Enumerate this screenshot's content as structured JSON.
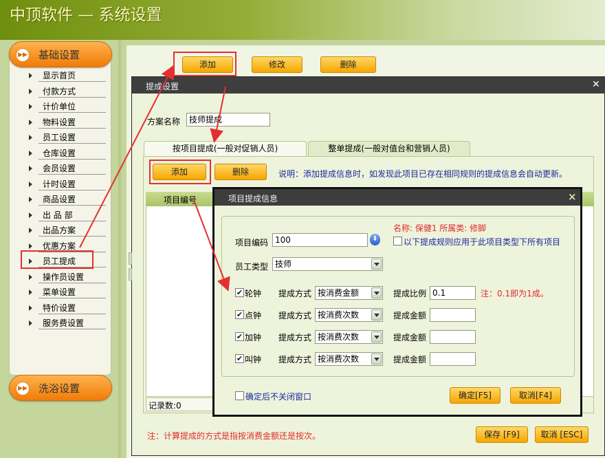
{
  "app": {
    "title": "中顶软件 — 系统设置"
  },
  "sidebar": {
    "section1": "基础设置",
    "section2": "洗浴设置",
    "items": [
      "显示首页",
      "付款方式",
      "计价单位",
      "物料设置",
      "员工设置",
      "仓库设置",
      "会员设置",
      "计时设置",
      "商品设置",
      "出 品 部",
      "出品方案",
      "优惠方案",
      "员工提成",
      "操作员设置",
      "菜单设置",
      "特价设置",
      "服务费设置"
    ],
    "active": "员工提成"
  },
  "toolbar": {
    "add": "添加",
    "edit": "修改",
    "delete": "删除"
  },
  "commission_dialog": {
    "title": "提成设置",
    "plan_name_label": "方案名称",
    "plan_name_value": "技师提成",
    "tabs": [
      "按项目提成(一般对促销人员)",
      "整单提成(一般对值台和营销人员)"
    ],
    "add": "添加",
    "delete": "删除",
    "note": "说明：添加提成信息时，如发现此项目已存在相同规则的提成信息会自动更新。",
    "column_header": "项目编号",
    "record_count": "记录数:0",
    "footer_note": "注：计算提成的方式是指按消费金额还是按次。",
    "save": "保存 [F9]",
    "cancel": "取消 [ESC]"
  },
  "item_dialog": {
    "title": "项目提成信息",
    "close_glyph": "×",
    "info_line": "名称: 保健1  所属类: 修脚",
    "code_label": "项目编码",
    "code_value": "100",
    "apply_all": "以下提成规则应用于此项目类型下所有项目",
    "emp_type_label": "员工类型",
    "emp_type_value": "技师",
    "method_label": "提成方式",
    "ratio_label": "提成比例",
    "amount_label": "提成金额",
    "ratio_note": "注：0.1即为1成。",
    "rows": [
      {
        "name": "轮钟",
        "method": "按消费金额",
        "value_label": "提成比例",
        "value": "0.1"
      },
      {
        "name": "点钟",
        "method": "按消费次数",
        "value_label": "提成金额",
        "value": ""
      },
      {
        "name": "加钟",
        "method": "按消费次数",
        "value_label": "提成金额",
        "value": ""
      },
      {
        "name": "叫钟",
        "method": "按消费次数",
        "value_label": "提成金额",
        "value": ""
      }
    ],
    "keep_open": "确定后不关闭窗口",
    "ok": "确定[F5]",
    "cancel": "取消[F4]"
  },
  "colors": {
    "orange": "#f6a600",
    "accent_red": "#e52f2f",
    "olive": "#93ad36"
  }
}
